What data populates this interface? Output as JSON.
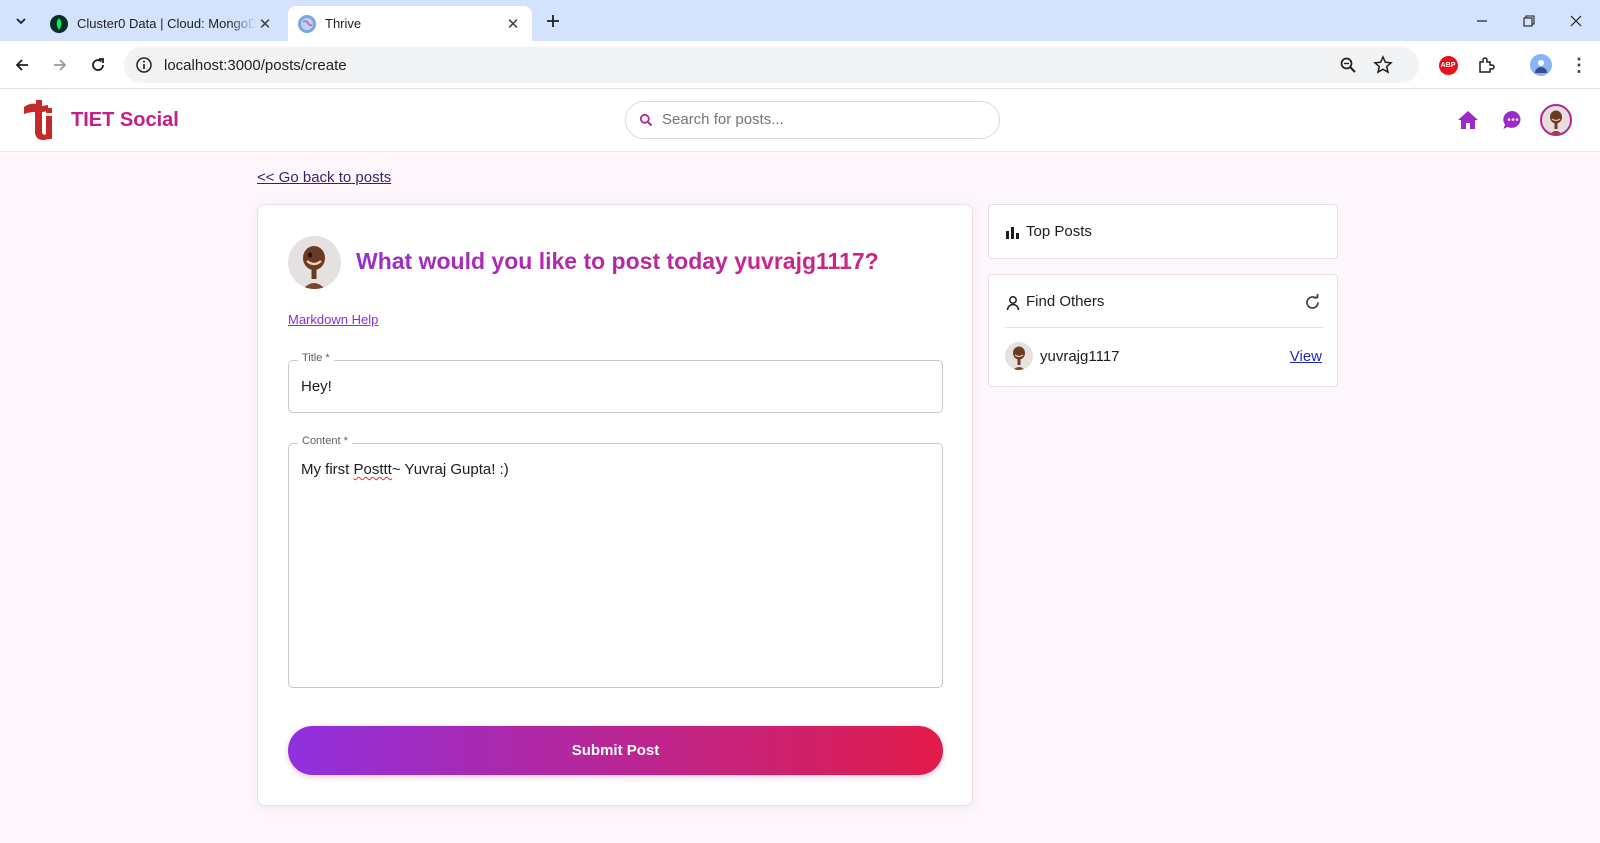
{
  "browser": {
    "tabs": [
      {
        "title": "Cluster0 Data | Cloud: MongoDB Cloud",
        "active": false,
        "icon": "mongodb-leaf-icon"
      },
      {
        "title": "Thrive",
        "active": true,
        "icon": "globe-icon"
      }
    ],
    "url": "localhost:3000/posts/create",
    "extensions": {
      "abp_label": "ABP"
    }
  },
  "app": {
    "brand": "TIET Social",
    "search_placeholder": "Search for posts...",
    "accent_color": "#c3208d"
  },
  "page": {
    "back_link": "<< Go back to posts",
    "heading": "What would you like to post today yuvrajg1117?",
    "markdown_help": "Markdown Help",
    "title_field": {
      "label": "Title *",
      "value": "Hey!"
    },
    "content_field": {
      "label": "Content *",
      "value_prefix": "My first ",
      "value_misspelled": "Posttt",
      "value_suffix": "~ Yuvraj Gupta! :)"
    },
    "submit_label": "Submit Post"
  },
  "sidebar": {
    "top_posts_label": "Top Posts",
    "find_others_label": "Find Others",
    "users": [
      {
        "name": "yuvrajg1117",
        "action": "View"
      }
    ]
  }
}
